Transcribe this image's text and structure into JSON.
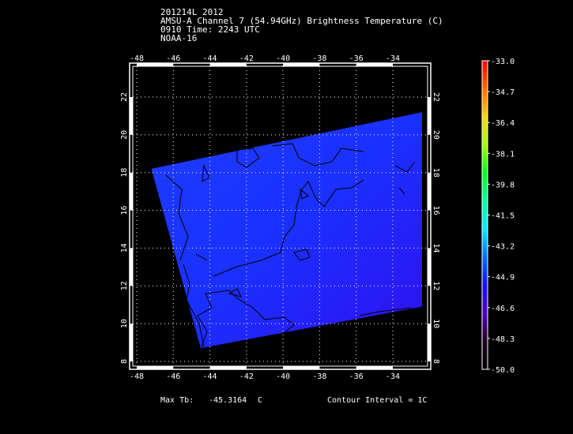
{
  "header": {
    "line1": "201214L 2012",
    "line2": "AMSU-A Channel 7 (54.94GHz) Brightness Temperature (C)",
    "line3": "0910 Time: 2243 UTC",
    "line4": "NOAA-16"
  },
  "footer": {
    "max_label": "Max Tb:",
    "max_value": "-45.3164",
    "max_unit": "C",
    "contour": "Contour Interval = 1C"
  },
  "chart_data": {
    "type": "heatmap",
    "title": "AMSU-A Channel 7 (54.94GHz) Brightness Temperature (C)",
    "x_ticks": [
      "-48",
      "-46",
      "-44",
      "-42",
      "-40",
      "-38",
      "-36",
      "-34"
    ],
    "x_values": [
      -48,
      -46,
      -44,
      -42,
      -40,
      -38,
      -36,
      -34
    ],
    "y_ticks": [
      "8",
      "10",
      "12",
      "14",
      "16",
      "18",
      "20",
      "22"
    ],
    "y_values": [
      8,
      10,
      12,
      14,
      16,
      18,
      20,
      22
    ],
    "xlim": [
      -48.4,
      -32.1
    ],
    "ylim": [
      7.5,
      23.9
    ],
    "grid": true,
    "swath_corners_lonlat": [
      [
        -47.2,
        18.2
      ],
      [
        -32.4,
        21.2
      ],
      [
        -32.4,
        10.9
      ],
      [
        -44.5,
        8.7
      ]
    ],
    "typical_value": -45.5,
    "colorbar": {
      "labels": [
        "-33.0",
        "-34.7",
        "-36.4",
        "-38.1",
        "-39.8",
        "-41.5",
        "-43.2",
        "-44.9",
        "-46.6",
        "-48.3",
        "-50.0"
      ],
      "min": -50.0,
      "max": -33.0,
      "colors": [
        "#ff0000",
        "#ff6a00",
        "#ffd400",
        "#a0ff00",
        "#00ff20",
        "#00ffa0",
        "#00e8ff",
        "#0070ff",
        "#1010ff",
        "#5000c0",
        "#200020",
        "#000000"
      ]
    },
    "contour_interval": 1
  }
}
